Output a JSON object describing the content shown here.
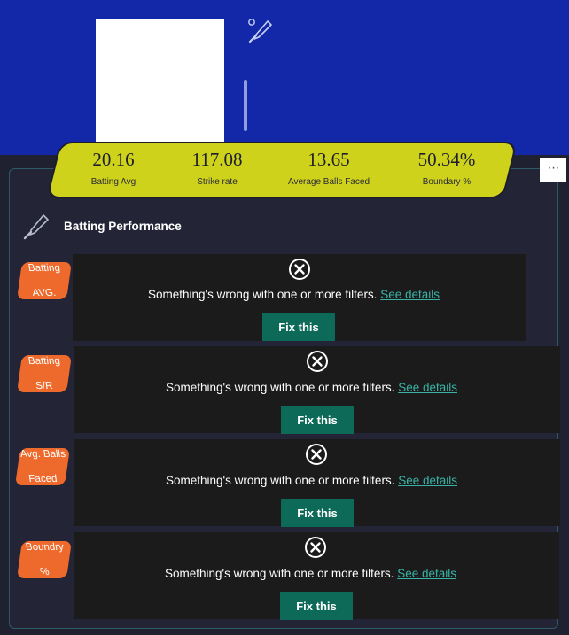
{
  "stats": [
    {
      "value": "20.16",
      "label": "Batting Avg"
    },
    {
      "value": "117.08",
      "label": "Strike rate"
    },
    {
      "value": "13.65",
      "label": "Average Balls Faced"
    },
    {
      "value": "50.34%",
      "label": "Boundary %"
    }
  ],
  "more_button": "···",
  "section": {
    "title": "Batting Performance",
    "icon": "cricket-bat-icon"
  },
  "cards": [
    {
      "tag": [
        "Batting",
        "AVG."
      ],
      "message": "Something's wrong with one or more filters.",
      "link": "See details",
      "button": "Fix this"
    },
    {
      "tag": [
        "Batting",
        "S/R"
      ],
      "message": "Something's wrong with one or more filters.",
      "link": "See details",
      "button": "Fix this"
    },
    {
      "tag": [
        "Avg. Balls",
        "Faced"
      ],
      "message": "Something's wrong with one or more filters.",
      "link": "See details",
      "button": "Fix this"
    },
    {
      "tag": [
        "Boundry",
        "%"
      ],
      "message": "Something's wrong with one or more filters.",
      "link": "See details",
      "button": "Fix this"
    }
  ],
  "colors": {
    "header": "#1228a8",
    "stats_bar": "#cfd21a",
    "tag": "#ee6a2c",
    "fix_button": "#0e6a58",
    "link": "#3ab3a6"
  }
}
